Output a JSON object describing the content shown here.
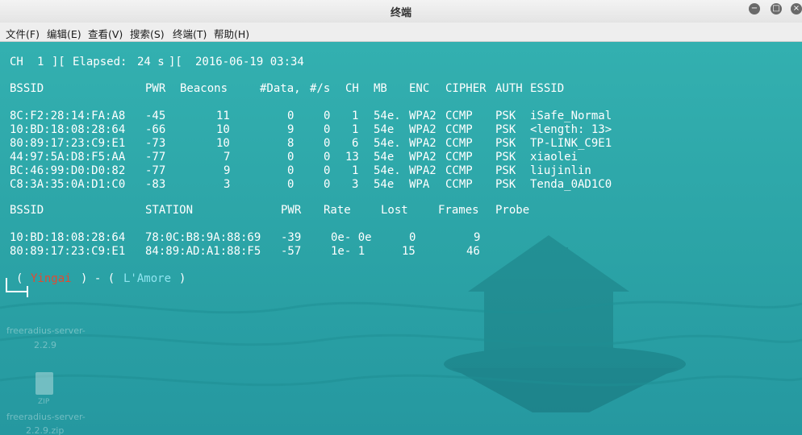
{
  "window": {
    "title": "终端",
    "buttons": [
      "−",
      "□",
      "×"
    ]
  },
  "menu": [
    "文件(F)",
    "编辑(E)",
    "查看(V)",
    "搜索(S)",
    "终端(T)",
    "帮助(H)"
  ],
  "status": {
    "ch_label": "CH",
    "ch_value": "1",
    "elapsed_label": "Elapsed:",
    "elapsed_value": "24 s",
    "datetime": "2016-06-19 03:34"
  },
  "ap_table": {
    "headers": [
      "BSSID",
      "PWR",
      "Beacons",
      "#Data,",
      "#/s",
      "CH",
      "MB",
      "ENC",
      "CIPHER",
      "AUTH",
      "ESSID"
    ],
    "rows": [
      [
        "8C:F2:28:14:FA:A8",
        "-45",
        "11",
        "0",
        "0",
        "1",
        "54e.",
        "WPA2",
        "CCMP",
        "PSK",
        "iSafe_Normal"
      ],
      [
        "10:BD:18:08:28:64",
        "-66",
        "10",
        "9",
        "0",
        "1",
        "54e",
        "WPA2",
        "CCMP",
        "PSK",
        "<length: 13>"
      ],
      [
        "80:89:17:23:C9:E1",
        "-73",
        "10",
        "8",
        "0",
        "6",
        "54e.",
        "WPA2",
        "CCMP",
        "PSK",
        "TP-LINK_C9E1"
      ],
      [
        "44:97:5A:D8:F5:AA",
        "-77",
        "7",
        "0",
        "0",
        "13",
        "54e",
        "WPA2",
        "CCMP",
        "PSK",
        "xiaolei"
      ],
      [
        "BC:46:99:D0:D0:82",
        "-77",
        "9",
        "0",
        "0",
        "1",
        "54e.",
        "WPA2",
        "CCMP",
        "PSK",
        "liujinlin"
      ],
      [
        "C8:3A:35:0A:D1:C0",
        "-83",
        "3",
        "0",
        "0",
        "3",
        "54e",
        "WPA",
        "CCMP",
        "PSK",
        "Tenda_0AD1C0"
      ]
    ]
  },
  "station_table": {
    "headers": [
      "BSSID",
      "STATION",
      "PWR",
      "Rate",
      "Lost",
      "Frames",
      "Probe"
    ],
    "rows": [
      [
        "10:BD:18:08:28:64",
        "78:0C:B8:9A:88:69",
        "-39",
        "0e- 0e",
        "0",
        "9",
        ""
      ],
      [
        "80:89:17:23:C9:E1",
        "84:89:AD:A1:88:F5",
        "-57",
        "1e- 1",
        "15",
        "46",
        ""
      ]
    ]
  },
  "prompt": {
    "user": "Yingai",
    "host": "L'Amore"
  },
  "desktop": {
    "labels": [
      "freeradius-server-",
      "2.2.9",
      "ZIP",
      "freeradius-server-",
      "2.2.9.zip"
    ]
  },
  "colors": {
    "terminal_bg": "#2aa3a5",
    "prompt_user": "#e24a32",
    "prompt_host": "#8fe4f0"
  }
}
